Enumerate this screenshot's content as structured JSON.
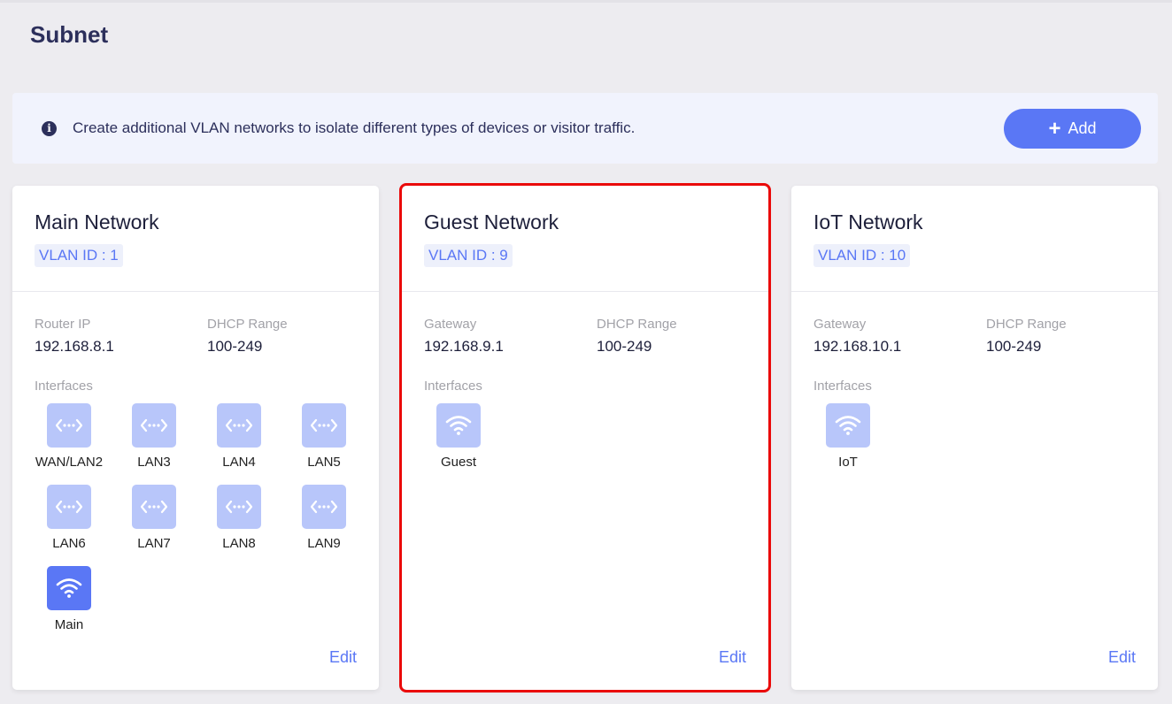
{
  "page": {
    "title": "Subnet"
  },
  "banner": {
    "icon": "info-icon",
    "text": "Create additional VLAN networks to isolate different types of devices or visitor traffic.",
    "add_label": "Add"
  },
  "colors": {
    "accent": "#5a77f5",
    "tile": "#b8c6fa",
    "selection": "#ea0a0a"
  },
  "cards": [
    {
      "title": "Main Network",
      "vlan": "VLAN ID : 1",
      "field1_label": "Router IP",
      "field1_value": "192.168.8.1",
      "field2_label": "DHCP Range",
      "field2_value": "100-249",
      "interfaces_label": "Interfaces",
      "interfaces": [
        {
          "name": "WAN/LAN2",
          "icon": "ethernet-port-icon",
          "active": false
        },
        {
          "name": "LAN3",
          "icon": "ethernet-port-icon",
          "active": false
        },
        {
          "name": "LAN4",
          "icon": "ethernet-port-icon",
          "active": false
        },
        {
          "name": "LAN5",
          "icon": "ethernet-port-icon",
          "active": false
        },
        {
          "name": "LAN6",
          "icon": "ethernet-port-icon",
          "active": false
        },
        {
          "name": "LAN7",
          "icon": "ethernet-port-icon",
          "active": false
        },
        {
          "name": "LAN8",
          "icon": "ethernet-port-icon",
          "active": false
        },
        {
          "name": "LAN9",
          "icon": "ethernet-port-icon",
          "active": false
        },
        {
          "name": "Main",
          "icon": "wifi-icon",
          "active": true
        }
      ],
      "edit_label": "Edit"
    },
    {
      "title": "Guest Network",
      "vlan": "VLAN ID : 9",
      "field1_label": "Gateway",
      "field1_value": "192.168.9.1",
      "field2_label": "DHCP Range",
      "field2_value": "100-249",
      "interfaces_label": "Interfaces",
      "interfaces": [
        {
          "name": "Guest",
          "icon": "wifi-icon",
          "active": false
        }
      ],
      "edit_label": "Edit"
    },
    {
      "title": "IoT Network",
      "vlan": "VLAN ID : 10",
      "field1_label": "Gateway",
      "field1_value": "192.168.10.1",
      "field2_label": "DHCP Range",
      "field2_value": "100-249",
      "interfaces_label": "Interfaces",
      "interfaces": [
        {
          "name": "IoT",
          "icon": "wifi-icon",
          "active": false
        }
      ],
      "edit_label": "Edit"
    }
  ]
}
